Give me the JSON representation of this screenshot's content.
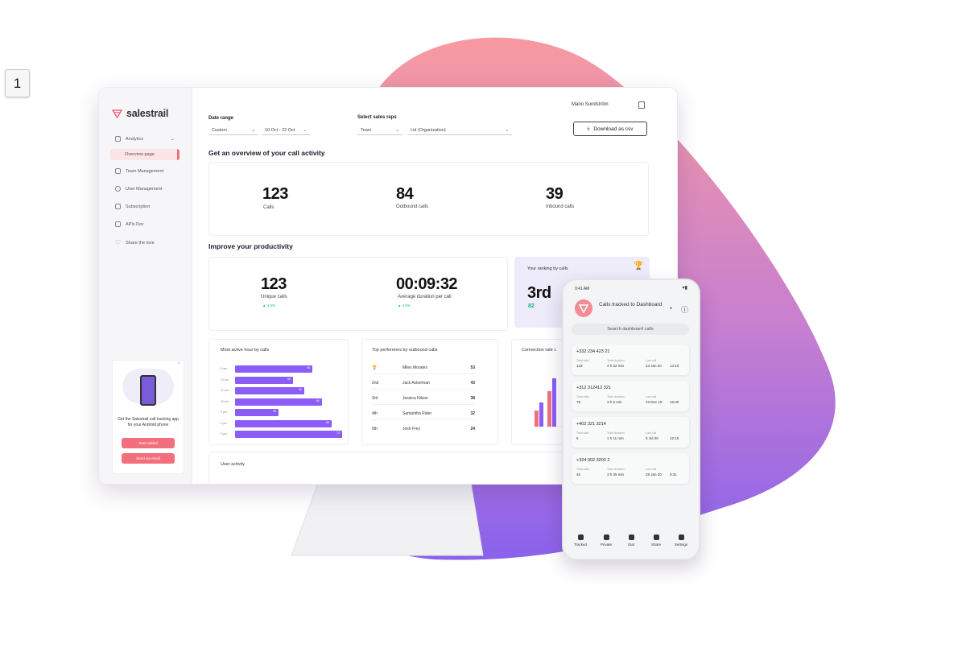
{
  "badge": "1",
  "app": {
    "brand": "salestrail",
    "user_name": "Mario Sundström",
    "download_label": "Download as csv",
    "accent_color": "#f26f7d",
    "bar_color": "#8b5cf6"
  },
  "sidebar": {
    "items": [
      {
        "label": "Analytics",
        "icon": "chart-icon"
      },
      {
        "label": "Overview page",
        "icon": ""
      },
      {
        "label": "Team Management",
        "icon": "team-icon"
      },
      {
        "label": "User Management",
        "icon": "user-icon"
      },
      {
        "label": "Subscription",
        "icon": "card-icon"
      },
      {
        "label": "APIs Doc",
        "icon": "api-icon"
      },
      {
        "label": "Share the love",
        "icon": "heart-icon"
      }
    ],
    "promo": {
      "text": "Get the Salestrail call tracking app for your Android phone",
      "button1": "Start added",
      "button2": "Send via email"
    }
  },
  "filters": {
    "date_range_label": "Date range",
    "date_mode": "Custom",
    "date_value": "10 Oct - 22 Oct",
    "reps_label": "Select sales reps",
    "reps_mode": "Team",
    "reps_value": "Lid (Organization)"
  },
  "overview": {
    "heading": "Get an overview of your call activity",
    "stats": [
      {
        "value": "123",
        "label": "Calls"
      },
      {
        "value": "84",
        "label": "Outbound calls"
      },
      {
        "value": "39",
        "label": "Inbound calls"
      }
    ]
  },
  "productivity": {
    "heading": "Improve your productivity",
    "unique_value": "123",
    "unique_label": "Unique calls",
    "unique_trend": "4.5%",
    "duration_value": "00:09:32",
    "duration_label": "Average duration per call",
    "duration_trend": "4.5%",
    "ranking_label": "Your ranking by calls",
    "ranking_value": "3rd",
    "ranking_sub": "82"
  },
  "active_hours": {
    "title": "Most active hour by calls",
    "rows": [
      {
        "hour": "9 am",
        "value": "54"
      },
      {
        "hour": "10 am",
        "value": "40"
      },
      {
        "hour": "11 am",
        "value": "50"
      },
      {
        "hour": "12 pm",
        "value": "60"
      },
      {
        "hour": "1 pm",
        "value": "35"
      },
      {
        "hour": "2 pm",
        "value": "66"
      },
      {
        "hour": "3 pm",
        "value": "72"
      }
    ]
  },
  "performers": {
    "title": "Top performers by outbound calls",
    "rows": [
      {
        "rank": "",
        "name": "Miles Morales",
        "value": "53"
      },
      {
        "rank": "2nd",
        "name": "Jack Ackerman",
        "value": "43"
      },
      {
        "rank": "3rd",
        "name": "Jessica Nilson",
        "value": "38"
      },
      {
        "rank": "4th",
        "name": "Samantha Rider",
        "value": "32"
      },
      {
        "rank": "5th",
        "name": "Josh Frey",
        "value": "24"
      }
    ]
  },
  "connection": {
    "title": "Connection rate c"
  },
  "user_activity": {
    "title": "User activity"
  },
  "phone": {
    "time": "9:41 AM",
    "title": "Calls tracked to Dashboard",
    "search": "Search dashboard calls",
    "cards": [
      {
        "number": "+332 234 423 21",
        "total_calls": "123",
        "total_duration": "4 h 32 min",
        "last_call": "23 Jan 20",
        "time": "13:10"
      },
      {
        "number": "+312 312412 321",
        "total_calls": "78",
        "total_duration": "3 h 5 min",
        "last_call": "13 Dec 19",
        "time": "15:30"
      },
      {
        "number": "+402 321 3214",
        "total_calls": "6",
        "total_duration": "1 h 11 min",
        "last_call": "5 Jul 20",
        "time": "12:15"
      },
      {
        "number": "+324 902 3203 2",
        "total_calls": "45",
        "total_duration": "3 h 35 min",
        "last_call": "29 Jan 20",
        "time": "9:31"
      }
    ],
    "keys": {
      "calls": "Total calls",
      "duration": "Total duration",
      "last": "Last call"
    },
    "nav": [
      "Tracked",
      "Private",
      "Dial",
      "Share",
      "Settings"
    ]
  }
}
